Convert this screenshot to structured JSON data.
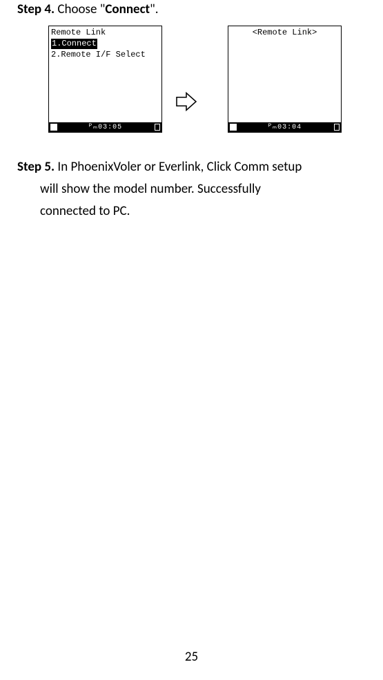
{
  "step4": {
    "label": "Step 4.",
    "text_prefix": " Choose \"",
    "bold_word": "Connect",
    "text_suffix": "\"."
  },
  "screen1": {
    "title": "Remote Link",
    "item1": "1.Connect",
    "item2": "2.Remote I/F Select",
    "status_time": "03:05"
  },
  "screen2": {
    "title": "<Remote Link>",
    "status_time": "03:04"
  },
  "step5": {
    "label": "Step 5.",
    "line1_rest": " In PhoenixVoler or Everlink, Click Comm setup",
    "line2": "will show the model number. Successfully",
    "line3": "connected to PC."
  },
  "page_number": "25"
}
